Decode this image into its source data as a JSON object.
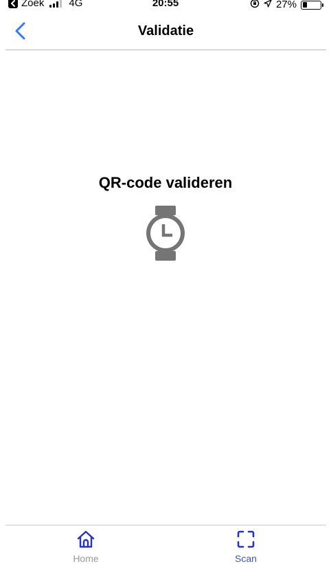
{
  "status_bar": {
    "back_app": "Zoek",
    "network": "4G",
    "time": "20:55",
    "battery_percent": "27%",
    "battery_level": 0.27
  },
  "nav": {
    "title": "Validatie",
    "back_icon": "chevron-left-icon"
  },
  "main": {
    "heading": "QR-code valideren",
    "icon": "watch-clock-icon"
  },
  "tab_bar": {
    "items": [
      {
        "label": "Home",
        "icon": "home-icon",
        "active": false
      },
      {
        "label": "Scan",
        "icon": "scan-icon",
        "active": true
      }
    ]
  },
  "colors": {
    "accent": "#2f7bf5",
    "tab_active": "#3b55c9",
    "tab_icon": "#2333c4",
    "tab_inactive": "#9a9a9a",
    "icon_gray": "#757575"
  }
}
